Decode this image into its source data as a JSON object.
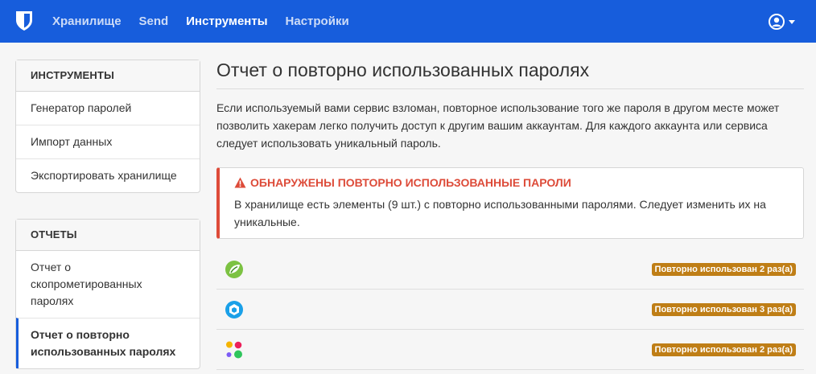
{
  "nav": {
    "items": [
      {
        "label": "Хранилище",
        "active": false
      },
      {
        "label": "Send",
        "active": false
      },
      {
        "label": "Инструменты",
        "active": true
      },
      {
        "label": "Настройки",
        "active": false
      }
    ]
  },
  "sidebar": {
    "tools": {
      "header": "ИНСТРУМЕНТЫ",
      "items": [
        "Генератор паролей",
        "Импорт данных",
        "Экспортировать хранилище"
      ]
    },
    "reports": {
      "header": "ОТЧЕТЫ",
      "items": [
        "Отчет о скопрометированных паролях",
        "Отчет о повторно использованных паролях"
      ]
    }
  },
  "main": {
    "title": "Отчет о повторно использованных паролях",
    "description": "Если используемый вами сервис взломан, повторное использование того же пароля в другом месте может позволить хакерам легко получить доступ к другим вашим аккаунтам. Для каждого аккаунта или сервиса следует использовать уникальный пароль.",
    "callout": {
      "title": "ОБНАРУЖЕНЫ ПОВТОРНО ИСПОЛЬЗОВАННЫЕ ПАРОЛИ",
      "text": "В хранилище есть элементы (9 шт.) с повторно использованными паролями. Следует изменить их на уникальные."
    },
    "items": [
      {
        "icon": "green-leaf-icon",
        "badge": "Повторно использован 2 раз(а)"
      },
      {
        "icon": "blue-cube-icon",
        "badge": "Повторно использован 3 раз(а)"
      },
      {
        "icon": "colored-dots-icon",
        "badge": "Повторно использован 2 раз(а)"
      }
    ]
  },
  "colors": {
    "brand": "#175ddc",
    "danger": "#dd4b39",
    "badge": "#bf7e16"
  }
}
